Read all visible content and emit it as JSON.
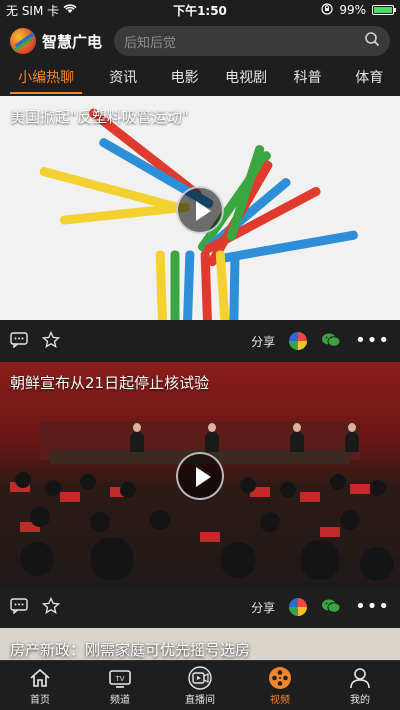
{
  "status_bar": {
    "carrier": "无 SIM 卡",
    "time": "下午1:50",
    "battery": "99%",
    "battery_level": 0.99
  },
  "header": {
    "app_name": "智慧广电",
    "search_placeholder": "后知后觉"
  },
  "tabs": [
    {
      "label": "小编热聊",
      "active": true
    },
    {
      "label": "资讯"
    },
    {
      "label": "电影"
    },
    {
      "label": "电视剧"
    },
    {
      "label": "科普"
    },
    {
      "label": "体育"
    }
  ],
  "cards": [
    {
      "title": "美国掀起\"反塑料吸管运动\""
    },
    {
      "title": "朝鲜宣布从21日起停止核试验"
    },
    {
      "title": "房产新政：刚需家庭可优先摇号选房"
    }
  ],
  "actions": {
    "share_label": "分享",
    "more": "•••"
  },
  "bottom_nav": [
    {
      "label": "首页",
      "icon": "home-icon"
    },
    {
      "label": "频道",
      "icon": "tv-icon"
    },
    {
      "label": "直播间",
      "icon": "live-icon"
    },
    {
      "label": "视频",
      "icon": "film-reel-icon",
      "active": true
    },
    {
      "label": "我的",
      "icon": "user-icon"
    }
  ],
  "colors": {
    "accent": "#f0862a",
    "background": "#1e1e1e"
  }
}
